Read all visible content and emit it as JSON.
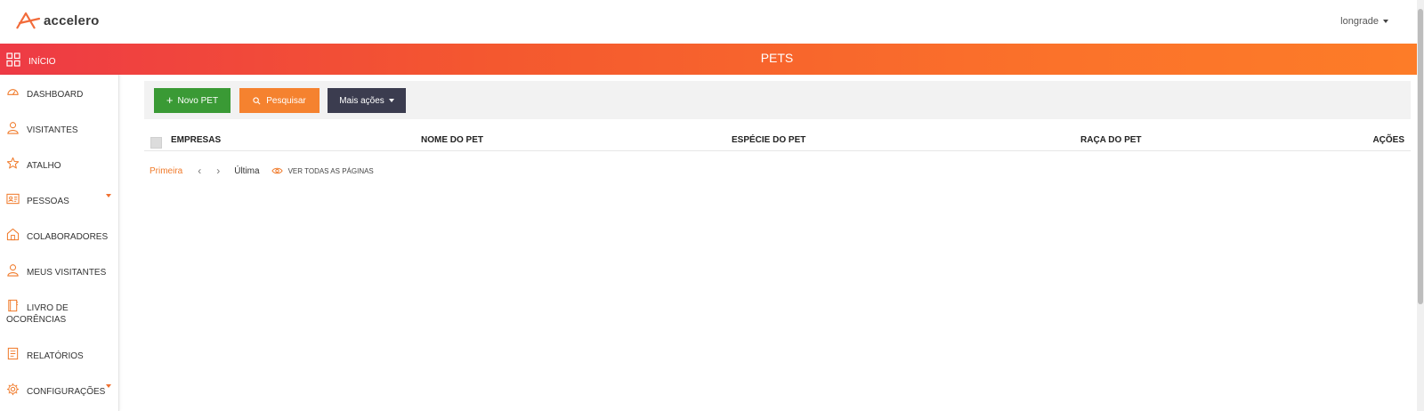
{
  "app": {
    "name": "accelero",
    "brand_color": "#f26b3a"
  },
  "user": {
    "name": "longrade"
  },
  "header": {
    "home_label": "INÍCIO",
    "page_title": "PETS"
  },
  "sidebar": {
    "items": [
      {
        "label": "DASHBOARD",
        "icon": "dashboard-icon"
      },
      {
        "label": "VISITANTES",
        "icon": "user-icon"
      },
      {
        "label": "ATALHO",
        "icon": "star-icon"
      },
      {
        "label": "PESSOAS",
        "icon": "id-card-icon",
        "has_submenu": true
      },
      {
        "label": "COLABORADORES",
        "icon": "building-icon"
      },
      {
        "label": "MEUS VISITANTES",
        "icon": "user-icon"
      },
      {
        "label_line1": "LIVRO DE",
        "label_line2": "OCORÊNCIAS",
        "icon": "book-icon"
      },
      {
        "label": "RELATÓRIOS",
        "icon": "report-icon"
      },
      {
        "label": "CONFIGURAÇÕES",
        "icon": "gear-icon",
        "has_submenu": true
      }
    ]
  },
  "toolbar": {
    "new_label": "Novo PET",
    "search_label": "Pesquisar",
    "more_label": "Mais ações"
  },
  "table": {
    "columns": [
      "EMPRESAS",
      "NOME DO PET",
      "ESPÉCIE DO PET",
      "RAÇA DO PET",
      "AÇÕES"
    ]
  },
  "pagination": {
    "first": "Primeira",
    "prev": "‹",
    "next": "›",
    "last": "Última",
    "view_all": "VER TODAS AS PÁGINAS"
  },
  "colors": {
    "green_button": "#3a9a35",
    "orange_button": "#f5822f",
    "dark_button": "#3b3c4f",
    "banner_start": "#ee3a45",
    "banner_end": "#fd7c28"
  }
}
